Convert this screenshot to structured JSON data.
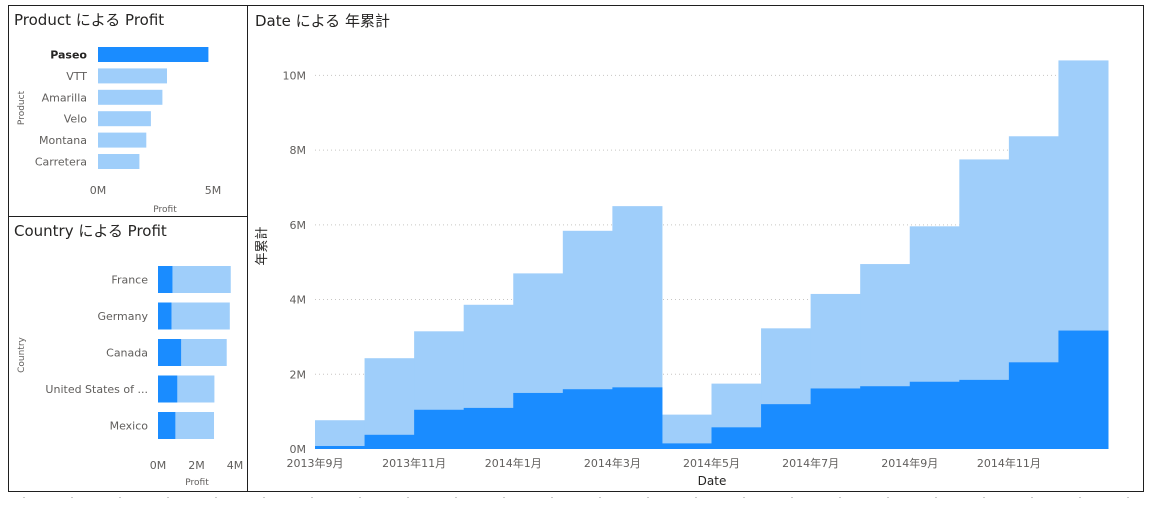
{
  "colors": {
    "dark": "#1a8cff",
    "light": "#9fcefa",
    "text": "#605e5c",
    "grid": "#c8c6c4"
  },
  "product_panel": {
    "title": "Product による Profit"
  },
  "country_panel": {
    "title": "Country による Profit"
  },
  "date_panel": {
    "title": "Date による 年累計"
  },
  "chart_data": [
    {
      "type": "bar",
      "orientation": "horizontal",
      "title": "Product による Profit",
      "xlabel": "Profit",
      "ylabel": "Product",
      "categories": [
        "Paseo",
        "VTT",
        "Amarilla",
        "Velo",
        "Montana",
        "Carretera"
      ],
      "values": [
        4.8,
        3.0,
        2.8,
        2.3,
        2.1,
        1.8
      ],
      "highlight_index": 0,
      "xlim": [
        0,
        5
      ],
      "xticks": [
        0,
        5
      ],
      "xtick_labels": [
        "0M",
        "5M"
      ]
    },
    {
      "type": "bar",
      "orientation": "horizontal",
      "stacked": true,
      "title": "Country による Profit",
      "xlabel": "Profit",
      "ylabel": "Country",
      "categories": [
        "France",
        "Germany",
        "Canada",
        "United States of ...",
        "Mexico"
      ],
      "series": [
        {
          "values": [
            0.75,
            0.7,
            1.2,
            1.0,
            0.9
          ]
        },
        {
          "values": [
            3.78,
            3.73,
            3.57,
            2.93,
            2.91
          ]
        }
      ],
      "xlim": [
        0,
        4
      ],
      "xticks": [
        0,
        2,
        4
      ],
      "xtick_labels": [
        "0M",
        "2M",
        "4M"
      ]
    },
    {
      "type": "area",
      "step": true,
      "title": "Date による 年累計",
      "xlabel": "Date",
      "ylabel": "年累計",
      "x": [
        "2013-09",
        "2013-10",
        "2013-11",
        "2013-12",
        "2014-01",
        "2014-02",
        "2014-03",
        "2014-04",
        "2014-05",
        "2014-06",
        "2014-07",
        "2014-08",
        "2014-09",
        "2014-10",
        "2014-11",
        "2014-12"
      ],
      "series": [
        {
          "values": [
            0.08,
            0.38,
            1.05,
            1.1,
            1.5,
            1.6,
            1.65,
            0.15,
            0.58,
            1.2,
            1.62,
            1.68,
            1.8,
            1.85,
            2.32,
            3.17
          ]
        },
        {
          "values": [
            0.77,
            2.43,
            3.15,
            3.86,
            4.7,
            5.84,
            6.5,
            0.92,
            1.75,
            3.23,
            4.15,
            4.95,
            5.96,
            7.75,
            8.37,
            10.4
          ]
        }
      ],
      "ylim": [
        0,
        11
      ],
      "yticks": [
        0,
        2,
        4,
        6,
        8,
        10
      ],
      "ytick_labels": [
        "0M",
        "2M",
        "4M",
        "6M",
        "8M",
        "10M"
      ],
      "xtick_labels": [
        "2013年9月",
        "2013年11月",
        "2014年1月",
        "2014年3月",
        "2014年5月",
        "2014年7月",
        "2014年9月",
        "2014年11月"
      ],
      "xtick_index": [
        0,
        2,
        4,
        6,
        8,
        10,
        12,
        14
      ],
      "grid": true
    }
  ]
}
